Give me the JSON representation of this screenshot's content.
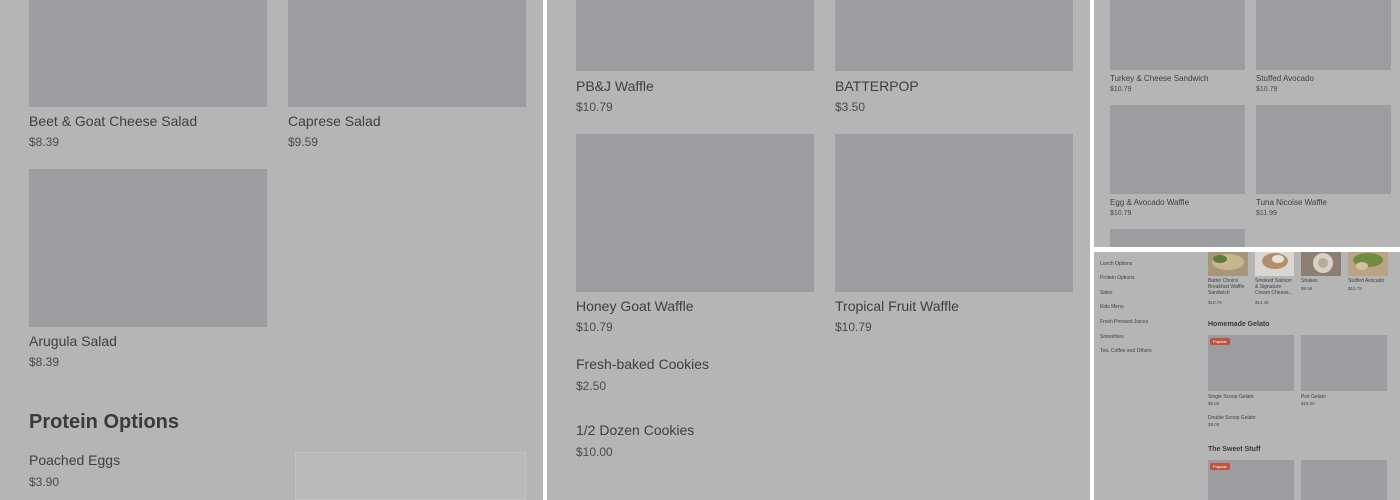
{
  "panel1": {
    "items": [
      {
        "name": "Beet & Goat Cheese Salad",
        "price": "$8.39"
      },
      {
        "name": "Caprese Salad",
        "price": "$9.59"
      },
      {
        "name": "Arugula Salad",
        "price": "$8.39"
      }
    ],
    "section_title": "Protein Options",
    "protein_items": [
      {
        "name": "Poached Eggs",
        "price": "$3.90"
      }
    ]
  },
  "panel2": {
    "items": [
      {
        "name": "PB&J Waffle",
        "price": "$10.79"
      },
      {
        "name": "BATTERPOP",
        "price": "$3.50"
      },
      {
        "name": "Honey Goat Waffle",
        "price": "$10.79"
      },
      {
        "name": "Tropical Fruit Waffle",
        "price": "$10.79"
      },
      {
        "name": "Fresh-baked Cookies",
        "price": "$2.50"
      },
      {
        "name": "1/2 Dozen Cookies",
        "price": "$10.00"
      }
    ]
  },
  "panel3": {
    "items": [
      {
        "name": "Turkey & Cheese Sandwich",
        "price": "$10.79"
      },
      {
        "name": "Stuffed Avocado",
        "price": "$10.79"
      },
      {
        "name": "Egg & Avocado Waffle",
        "price": "$10.79"
      },
      {
        "name": "Tuna Nicoise Waffle",
        "price": "$11.99"
      }
    ]
  },
  "panel4": {
    "sidebar": [
      "Lunch Options",
      "Protein Options",
      "Sides",
      "Kids Menu",
      "Fresh Pressed Juices",
      "Smoothies",
      "Tea, Coffee and Others"
    ],
    "popular_items": [
      {
        "name": "Batter Choice Breakfast Waffle Sandwich",
        "price": "$10.79"
      },
      {
        "name": "Smoked Salmon & Signature Cream Cheese...",
        "price": "$14.39"
      },
      {
        "name": "Shakes",
        "price": "$9.59"
      },
      {
        "name": "Stuffed Avocado",
        "price": "$10.79"
      }
    ],
    "gelato_title": "Homemade Gelato",
    "badge": "Popular",
    "gelato_items": [
      {
        "name": "Single Scoop Gelato",
        "price": "$6.00"
      },
      {
        "name": "Pint Gelato",
        "price": "$18.00"
      },
      {
        "name": "Double Scoop Gelato",
        "price": "$9.00"
      }
    ],
    "sweet_title": "The Sweet Stuff"
  },
  "colors": {
    "overlay": "#b5b5b5",
    "placeholder": "#9c9ca1",
    "badge": "#c0533d",
    "text": "#3f3f3f"
  }
}
